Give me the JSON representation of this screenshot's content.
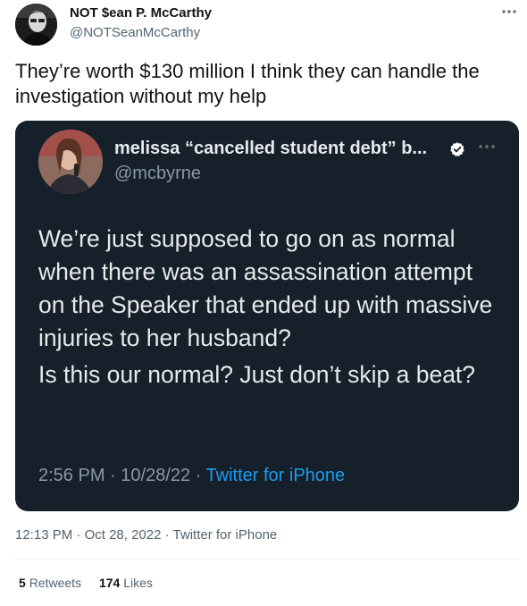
{
  "tweet": {
    "author_name": "NOT $ean P. McCarthy",
    "author_handle": "@NOTSeanMcCarthy",
    "more_icon": "more-horizontal-icon",
    "text": "They’re worth $130 million I think they can handle the investigation without my help",
    "time": "12:13 PM",
    "date": "Oct 28, 2022",
    "source": "Twitter for iPhone",
    "retweets_count": "5",
    "retweets_label": "Retweets",
    "likes_count": "174",
    "likes_label": "Likes"
  },
  "quoted_tweet": {
    "author_name": "melissa “cancelled student debt” b...",
    "author_handle": "@mcbyrne",
    "verified_icon": "verified-badge-icon",
    "paragraph_1": "We’re just supposed to go on as normal when there was an assassination attempt on the Speaker that ended up with massive injuries to her husband?",
    "paragraph_2": "Is this our normal? Just don’t skip a beat?",
    "time": "2:56 PM",
    "date": "10/28/22",
    "source": "Twitter for iPhone"
  },
  "separator": " · ",
  "colors": {
    "quote_background": "#15202b",
    "link_blue": "#1d9bf0",
    "secondary_text": "#536471",
    "primary_text": "#0f1419"
  }
}
